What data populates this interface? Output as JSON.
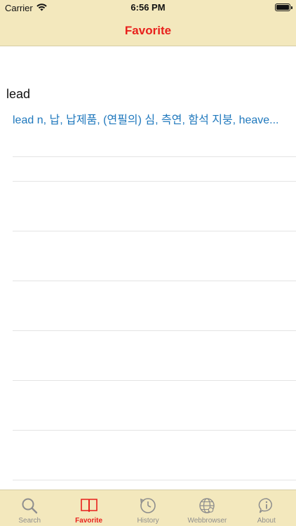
{
  "status_bar": {
    "carrier": "Carrier",
    "time": "6:56 PM",
    "battery_level": 1.0
  },
  "nav": {
    "title": "Favorite"
  },
  "list": {
    "section_header": "lead",
    "rows": [
      {
        "text": "lead  n, 납, 납제품, (연필의) 심, 측연, 함석 지붕, heave..."
      },
      {
        "text": ""
      },
      {
        "text": ""
      },
      {
        "text": ""
      },
      {
        "text": ""
      },
      {
        "text": ""
      },
      {
        "text": ""
      }
    ]
  },
  "tabs": [
    {
      "label": "Search",
      "icon": "magnifier-icon",
      "active": false
    },
    {
      "label": "Favorite",
      "icon": "open-book-icon",
      "active": true
    },
    {
      "label": "History",
      "icon": "clock-history-icon",
      "active": false
    },
    {
      "label": "Webbrowser",
      "icon": "globe-icon",
      "active": false
    },
    {
      "label": "About",
      "icon": "info-icon",
      "active": false
    }
  ],
  "colors": {
    "accent": "#e8201c",
    "link": "#1f78bd",
    "bar_bg": "#f3e8bd",
    "inactive": "#8e8e8e"
  }
}
